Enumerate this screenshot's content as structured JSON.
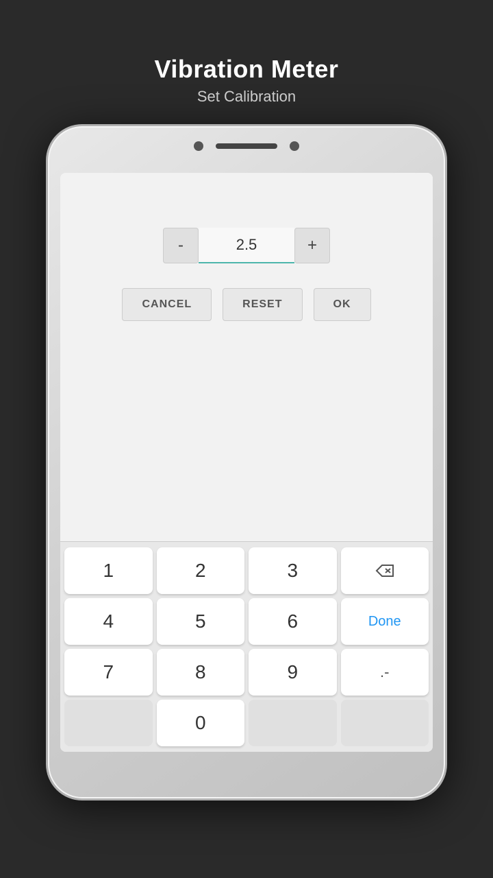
{
  "header": {
    "title": "Vibration Meter",
    "subtitle": "Set Calibration"
  },
  "stepper": {
    "minus_label": "-",
    "plus_label": "+",
    "value": "2.5"
  },
  "buttons": {
    "cancel": "CANCEL",
    "reset": "RESET",
    "ok": "OK"
  },
  "keyboard": {
    "rows": [
      [
        "1",
        "2",
        "3",
        "⌫"
      ],
      [
        "4",
        "5",
        "6",
        "Done"
      ],
      [
        "7",
        "8",
        "9",
        ".-"
      ],
      [
        "",
        "0",
        "",
        ""
      ]
    ]
  }
}
